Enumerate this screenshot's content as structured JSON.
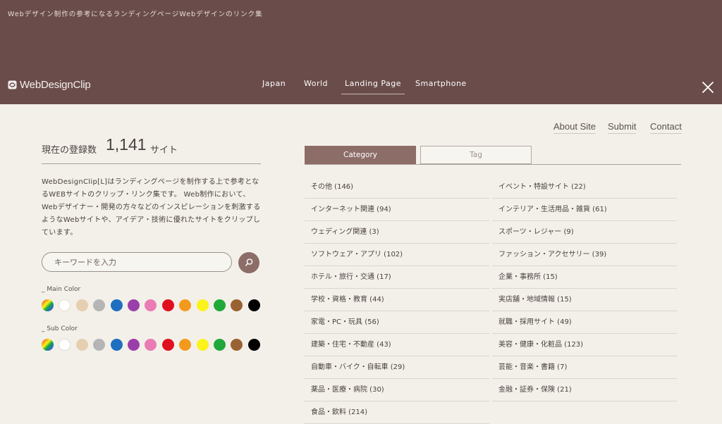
{
  "header": {
    "tagline": "Webデザイン制作の参考になるランディングページWebデザインのリンク集",
    "logo_text": "WebDesignClip",
    "nav": [
      {
        "label": "Japan",
        "active": false
      },
      {
        "label": "World",
        "active": false
      },
      {
        "label": "Landing Page",
        "active": true
      },
      {
        "label": "Smartphone",
        "active": false
      }
    ],
    "close_icon": "close-icon"
  },
  "top_links": [
    "About Site",
    "Submit",
    "Contact"
  ],
  "count": {
    "label": "現在の登録数",
    "value": "1,141",
    "unit": "サイト"
  },
  "description": "WebDesignClip[L]はランディングページを制作する上で参考となるWEBサイトのクリップ・リンク集です。 Web制作において、Webデザイナー・開発の方々などのインスピレーションを刺激するようなWebサイトや、アイデア・技術に優れたサイトをクリップしています。",
  "search": {
    "placeholder": "キーワードを入力",
    "value": "",
    "button_icon": "search-icon"
  },
  "colors": {
    "main_label": "_ Main Color",
    "sub_label": "_ Sub Color",
    "swatches": [
      {
        "name": "rainbow",
        "hex": "multi"
      },
      {
        "name": "white",
        "hex": "#ffffff"
      },
      {
        "name": "beige",
        "hex": "#e6cfb0"
      },
      {
        "name": "gray",
        "hex": "#b5b5b5"
      },
      {
        "name": "blue",
        "hex": "#1f6fc0"
      },
      {
        "name": "purple",
        "hex": "#9b3fa8"
      },
      {
        "name": "pink",
        "hex": "#ea7bb4"
      },
      {
        "name": "red",
        "hex": "#e0101e"
      },
      {
        "name": "orange",
        "hex": "#f39a1e"
      },
      {
        "name": "yellow",
        "hex": "#fbf31c"
      },
      {
        "name": "green",
        "hex": "#21a83a"
      },
      {
        "name": "brown",
        "hex": "#9a6233"
      },
      {
        "name": "black",
        "hex": "#000000"
      }
    ]
  },
  "tabs": [
    {
      "label": "Category",
      "active": true
    },
    {
      "label": "Tag",
      "active": false
    }
  ],
  "categories_left": [
    "その他 (146)",
    "インターネット関連 (94)",
    "ウェディング関連 (3)",
    "ソフトウェア・アプリ (102)",
    "ホテル・旅行・交通 (17)",
    "学校・資格・教育 (44)",
    "家電・PC・玩具 (56)",
    "建築・住宅・不動産 (43)",
    "自動車・バイク・自転車 (29)",
    "薬品・医療・病院 (30)",
    "食品・飲料 (214)"
  ],
  "categories_right": [
    "イベント・特設サイト (22)",
    "インテリア・生活用品・雑貨 (61)",
    "スポーツ・レジャー (9)",
    "ファッション・アクセサリー (39)",
    "企業・事務所 (15)",
    "実店舗・地域情報 (15)",
    "就職・採用サイト (49)",
    "美容・健康・化粧品 (123)",
    "芸能・音楽・書籍 (7)",
    "金融・証券・保険 (21)"
  ]
}
